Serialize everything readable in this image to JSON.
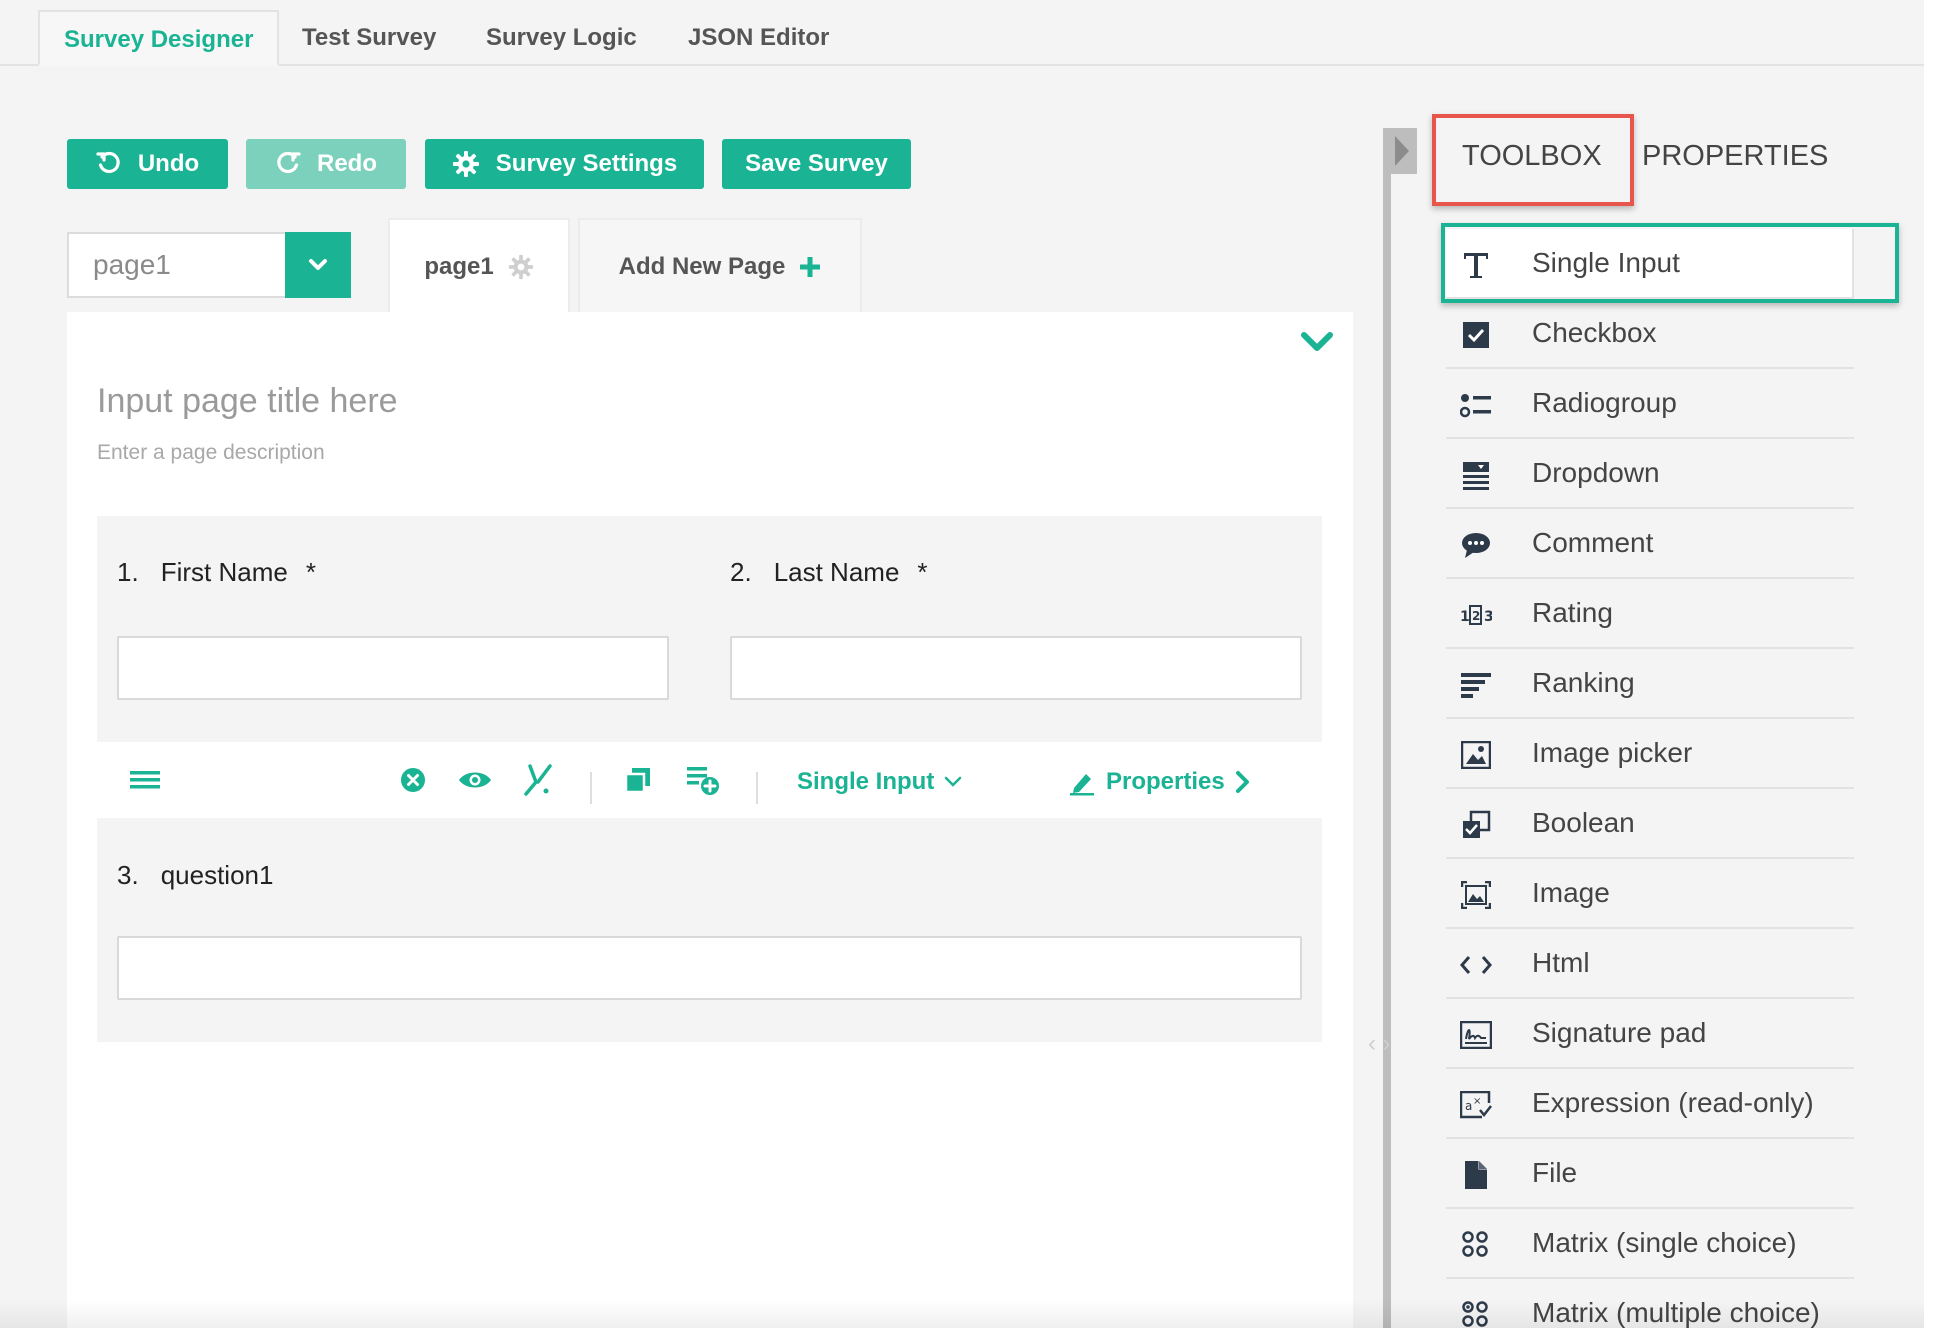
{
  "top_tabs": [
    "Survey Designer",
    "Test Survey",
    "Survey Logic",
    "JSON Editor"
  ],
  "toolbar": {
    "undo": "Undo",
    "redo": "Redo",
    "settings": "Survey Settings",
    "save": "Save Survey"
  },
  "page_selector": {
    "value": "page1"
  },
  "page_tabs": {
    "current": "page1",
    "add": "Add New Page"
  },
  "page": {
    "title_placeholder": "Input page title here",
    "desc_placeholder": "Enter a page description"
  },
  "questions": [
    {
      "num": "1.",
      "title": "First Name",
      "required": "*"
    },
    {
      "num": "2.",
      "title": "Last Name",
      "required": "*"
    },
    {
      "num": "3.",
      "title": "question1",
      "required": ""
    }
  ],
  "question_toolbar": {
    "type": "Single Input",
    "properties": "Properties"
  },
  "side_tabs": {
    "toolbox": "TOOLBOX",
    "properties": "PROPERTIES"
  },
  "toolbox_items": [
    {
      "label": "Single Input",
      "icon": "text-icon"
    },
    {
      "label": "Checkbox",
      "icon": "checkbox-icon"
    },
    {
      "label": "Radiogroup",
      "icon": "radiogroup-icon"
    },
    {
      "label": "Dropdown",
      "icon": "dropdown-icon"
    },
    {
      "label": "Comment",
      "icon": "comment-icon"
    },
    {
      "label": "Rating",
      "icon": "rating-icon"
    },
    {
      "label": "Ranking",
      "icon": "ranking-icon"
    },
    {
      "label": "Image picker",
      "icon": "image-picker-icon"
    },
    {
      "label": "Boolean",
      "icon": "boolean-icon"
    },
    {
      "label": "Image",
      "icon": "image-icon"
    },
    {
      "label": "Html",
      "icon": "html-icon"
    },
    {
      "label": "Signature pad",
      "icon": "signature-icon"
    },
    {
      "label": "Expression (read-only)",
      "icon": "expression-icon"
    },
    {
      "label": "File",
      "icon": "file-icon"
    },
    {
      "label": "Matrix (single choice)",
      "icon": "matrix-single-icon"
    },
    {
      "label": "Matrix (multiple choice)",
      "icon": "matrix-multiple-icon"
    }
  ],
  "colors": {
    "accent": "#1ab394",
    "accent_disabled": "#7cd1bc",
    "highlight_red": "#e8564b"
  }
}
